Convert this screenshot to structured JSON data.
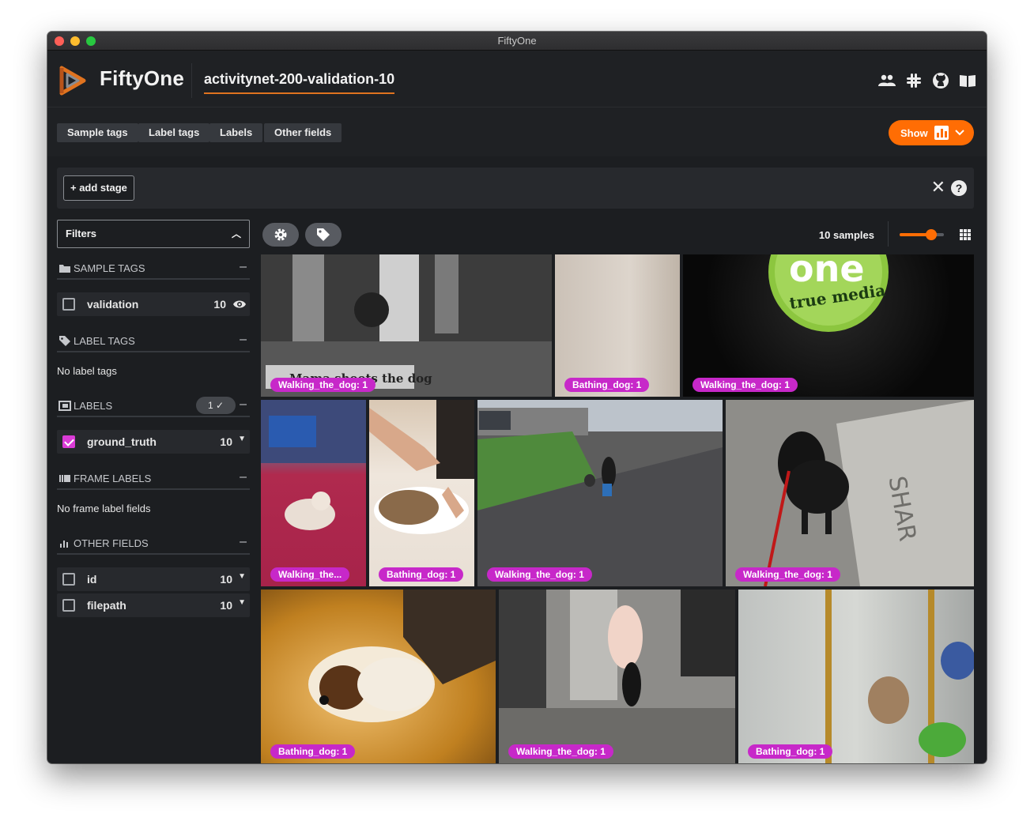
{
  "window": {
    "title": "FiftyOne"
  },
  "header": {
    "brand": "FiftyOne",
    "dataset": "activitynet-200-validation-10",
    "icons": [
      "people-icon",
      "slack-icon",
      "github-icon",
      "book-icon"
    ]
  },
  "tabs": [
    "Sample tags",
    "Label tags",
    "Labels",
    "Other fields"
  ],
  "show_button": {
    "label": "Show"
  },
  "stages": {
    "add_label": "+ add stage"
  },
  "sidebar": {
    "filters_label": "Filters",
    "sample_tags": {
      "title": "SAMPLE TAGS",
      "items": [
        {
          "name": "validation",
          "count": "10"
        }
      ]
    },
    "label_tags": {
      "title": "LABEL TAGS",
      "empty": "No label tags"
    },
    "labels": {
      "title": "LABELS",
      "badge": "1 ✓",
      "items": [
        {
          "name": "ground_truth",
          "count": "10",
          "checked": true
        }
      ]
    },
    "frame_labels": {
      "title": "FRAME LABELS",
      "empty": "No frame label fields"
    },
    "other_fields": {
      "title": "OTHER FIELDS",
      "items": [
        {
          "name": "id",
          "count": "10"
        },
        {
          "name": "filepath",
          "count": "10"
        }
      ]
    }
  },
  "grid": {
    "samples_label": "10 samples",
    "zoom_level": 0.72,
    "tiles": [
      {
        "label": "Walking_the_dog: 1",
        "selected": true,
        "overlay_text": "Mama shoots the dog"
      },
      {
        "label": "Bathing_dog: 1"
      },
      {
        "label": "Walking_the_dog: 1",
        "overlay_text": "one true media"
      },
      {
        "label": "Walking_the..."
      },
      {
        "label": "Bathing_dog: 1"
      },
      {
        "label": "Walking_the_dog: 1"
      },
      {
        "label": "Walking_the_dog: 1"
      },
      {
        "label": "Bathing_dog: 1"
      },
      {
        "label": "Walking_the_dog: 1"
      },
      {
        "label": "Bathing_dog: 1"
      }
    ]
  },
  "colors": {
    "accent": "#ff6d04",
    "label_pill": "#c728c9",
    "checkbox": "#da3bd6",
    "background": "#1c1e21"
  }
}
